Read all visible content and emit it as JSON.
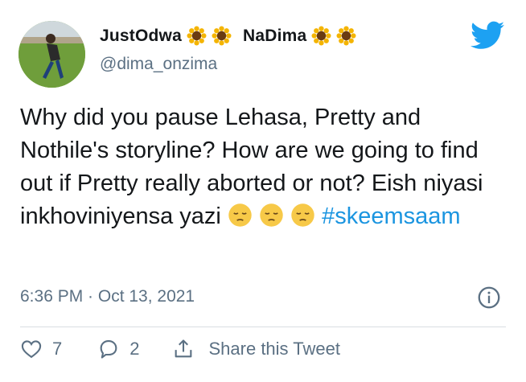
{
  "user": {
    "name_part1": "JustOdwa",
    "name_part2": "NaDima",
    "handle": "@dima_onzima"
  },
  "tweet": {
    "text": "Why did you pause Lehasa, Pretty and Nothile's storyline? How are we going to find out if Pretty really aborted or not? Eish niyasi inkhoviniyensa yazi",
    "hashtag": "#skeemsaam",
    "timestamp": "6:36 PM · Oct 13, 2021"
  },
  "actions": {
    "likes": "7",
    "replies": "2",
    "share_label": "Share this Tweet"
  },
  "icons": {
    "brand": "twitter-bird-icon",
    "like": "heart-icon",
    "reply": "comment-icon",
    "share": "share-icon",
    "info": "info-icon",
    "emoji": "pensive-face-emoji",
    "flower": "sunflower-emoji"
  },
  "colors": {
    "twitter_blue": "#1da1f2",
    "hashtag": "#1b95e0",
    "muted": "#5b7083",
    "text": "#14171a"
  }
}
